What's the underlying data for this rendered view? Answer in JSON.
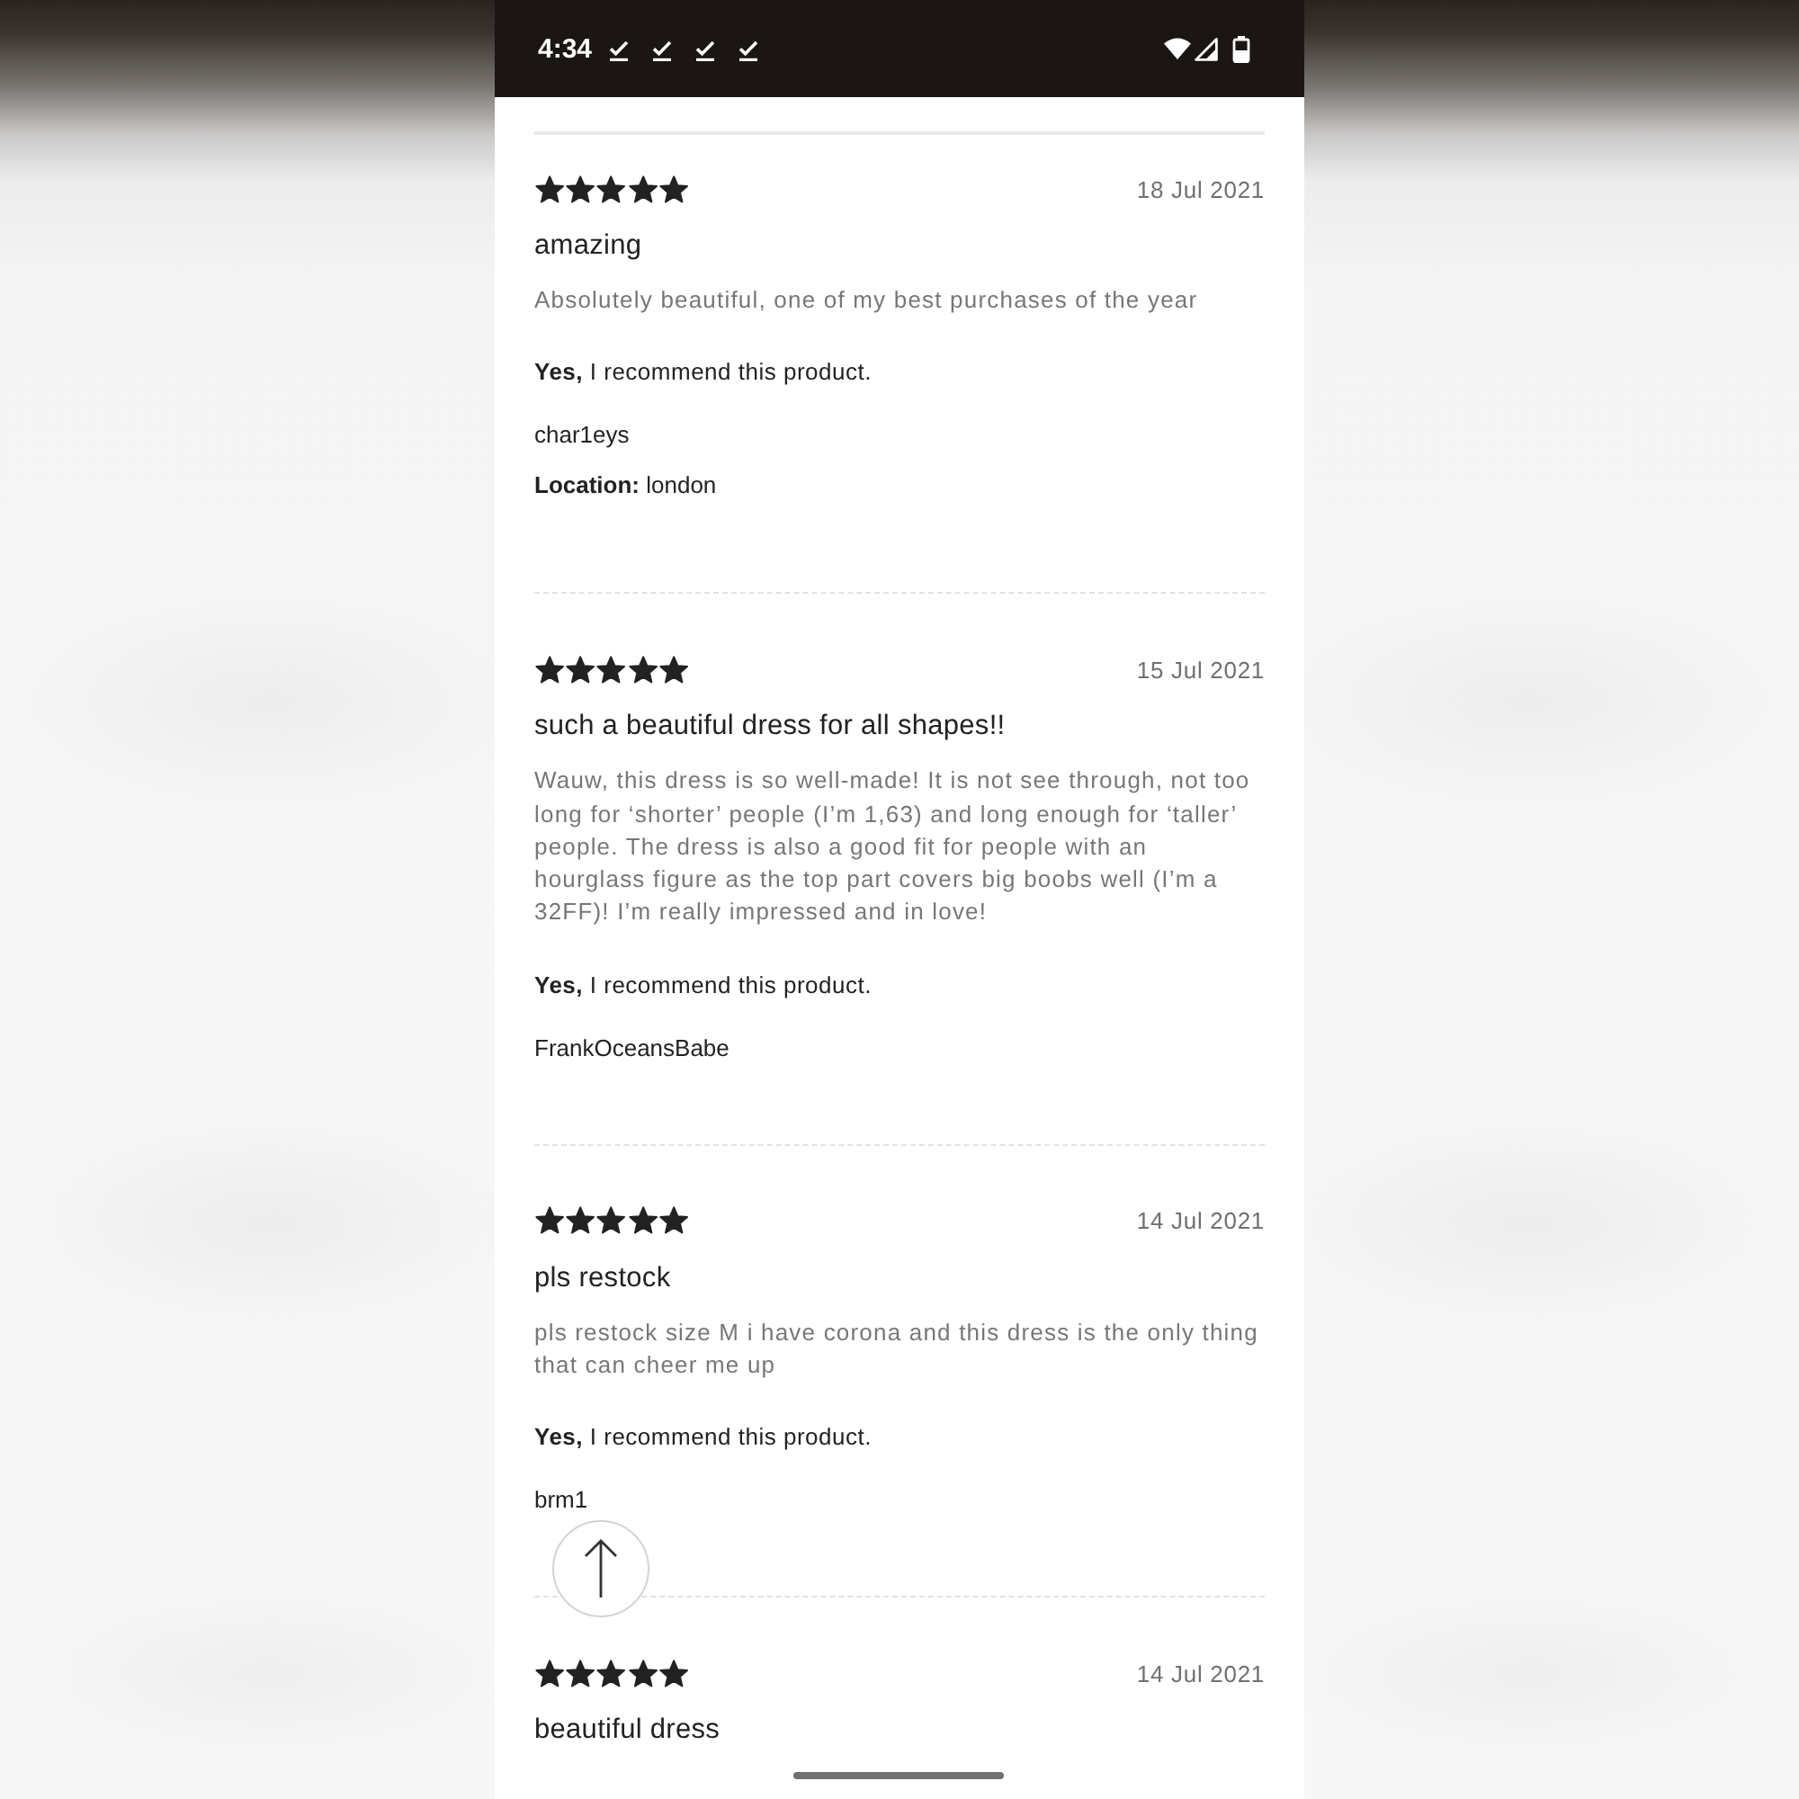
{
  "status_bar": {
    "time": "4:34"
  },
  "reviews": [
    {
      "stars": 5,
      "date": "18 Jul 2021",
      "title": "amazing",
      "body": "Absolutely beautiful, one of my best purchases of the year",
      "recommendation": "**Yes,** I recommend this product.",
      "username": "char1eys",
      "location": "**Location:** london"
    },
    {
      "stars": 5,
      "date": "15 Jul 2021",
      "title": "such a beautiful dress for all shapes!!",
      "body": "Wauw, this dress is so well-made! It is not see through, not too long for ‘shorter’ people (I’m 1,63) and long enough for ‘taller’ people. The dress is also a good fit for people with an hourglass figure as the top part covers big boobs well (I’m a 32FF)! I’m really impressed and in love!",
      "recommendation": "**Yes,** I recommend this product.",
      "username": "FrankOceansBabe"
    },
    {
      "stars": 5,
      "date": "14 Jul 2021",
      "title": "pls restock",
      "body": "pls restock size M i have corona and this dress is the only thing that can cheer me up",
      "recommendation": "**Yes,** I recommend this product.",
      "username": "brm1"
    },
    {
      "stars": 5,
      "date": "14 Jul 2021",
      "title": "beautiful dress"
    }
  ]
}
